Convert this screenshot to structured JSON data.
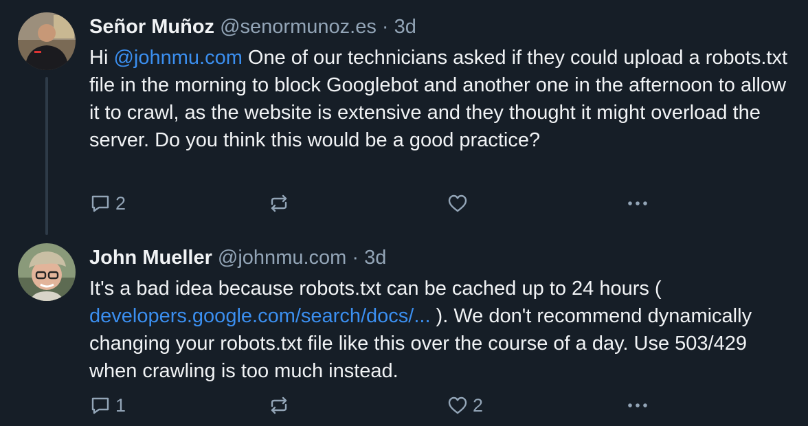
{
  "posts": [
    {
      "author_name": "Señor Muñoz",
      "handle": "@senormunoz.es",
      "separator": "·",
      "time": "3d",
      "body_before": "Hi ",
      "mention": "@johnmu.com",
      "body_after": " One of our technicians asked if they could upload a robots.txt file in the morning to block Googlebot and another one in the afternoon to allow it to crawl, as the website is extensive and they thought it might overload the server. Do you think this would be a good practice?",
      "reply_count": "2",
      "repost_count": "",
      "like_count": ""
    },
    {
      "author_name": "John Mueller",
      "handle": "@johnmu.com",
      "separator": "·",
      "time": "3d",
      "body_before": "It's a bad idea because robots.txt can be cached up to 24 hours ( ",
      "link": "developers.google.com/search/docs/...",
      "body_after": " ). We don't recommend dynamically changing your robots.txt file like this over the course of a day. Use 503/429 when crawling is too much instead.",
      "reply_count": "1",
      "repost_count": "",
      "like_count": "2"
    }
  ],
  "icons": [
    "reply-icon",
    "repost-icon",
    "like-icon",
    "more-options-icon"
  ],
  "colors": {
    "background": "#161e27",
    "text": "#f1f3f5",
    "muted": "#93a5b7",
    "link": "#3b8ff0",
    "thread_line": "#2e3b48"
  }
}
